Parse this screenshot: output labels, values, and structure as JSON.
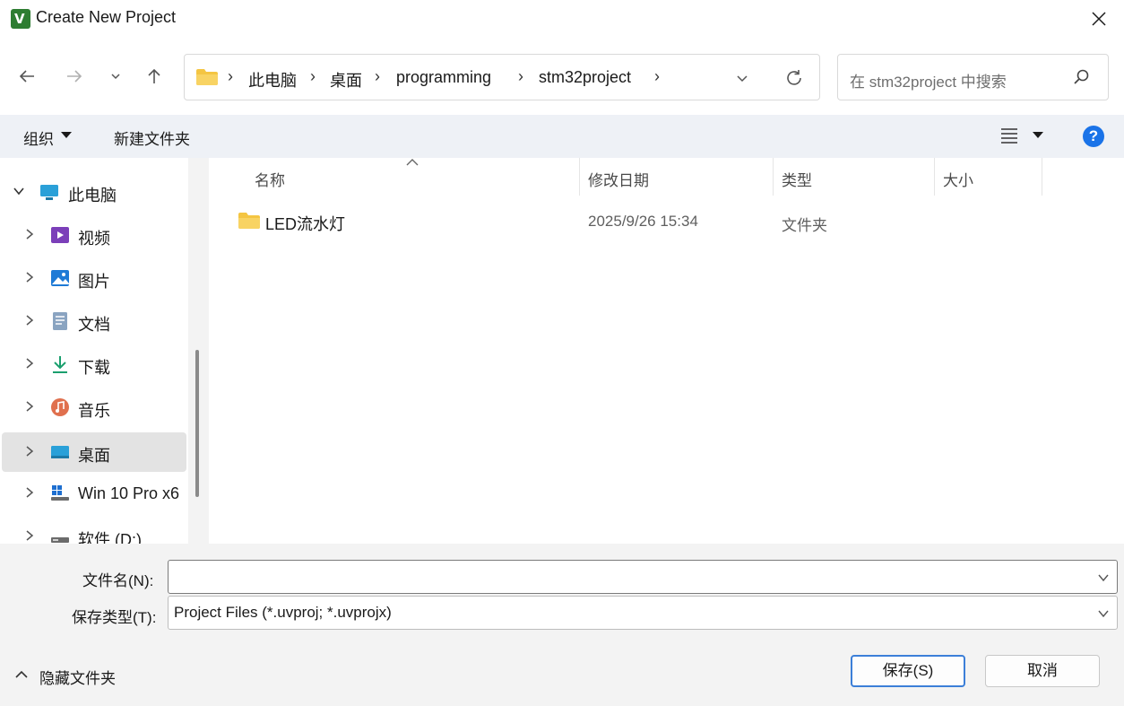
{
  "window": {
    "title": "Create New Project"
  },
  "nav": {
    "breadcrumb": [
      "此电脑",
      "桌面",
      "programming",
      "stm32project"
    ],
    "search_placeholder": "在 stm32project 中搜索"
  },
  "commands": {
    "organize": "组织",
    "new_folder": "新建文件夹"
  },
  "sidebar": {
    "items": [
      {
        "label": "此电脑",
        "icon": "computer-icon"
      },
      {
        "label": "视频",
        "icon": "video-icon"
      },
      {
        "label": "图片",
        "icon": "picture-icon"
      },
      {
        "label": "文档",
        "icon": "document-icon"
      },
      {
        "label": "下载",
        "icon": "download-icon"
      },
      {
        "label": "音乐",
        "icon": "music-icon"
      },
      {
        "label": "桌面",
        "icon": "desktop-icon",
        "selected": true
      },
      {
        "label": "Win 10 Pro x6",
        "icon": "windows-drive-icon"
      },
      {
        "label": "软件 (D:)",
        "icon": "drive-icon"
      }
    ]
  },
  "columns": {
    "name": "名称",
    "modified": "修改日期",
    "type": "类型",
    "size": "大小"
  },
  "files": [
    {
      "name": "LED流水灯",
      "modified": "2025/9/26 15:34",
      "type": "文件夹",
      "size": ""
    }
  ],
  "form": {
    "filename_label": "文件名(N):",
    "filename_value": "",
    "filetype_label": "保存类型(T):",
    "filetype_value": "Project Files (*.uvproj; *.uvprojx)"
  },
  "footer": {
    "hide_folders": "隐藏文件夹",
    "save": "保存(S)",
    "cancel": "取消"
  },
  "colors": {
    "accent": "#1a73e8",
    "selected_bg": "#e3e3e3",
    "folder": "#f4c542"
  }
}
